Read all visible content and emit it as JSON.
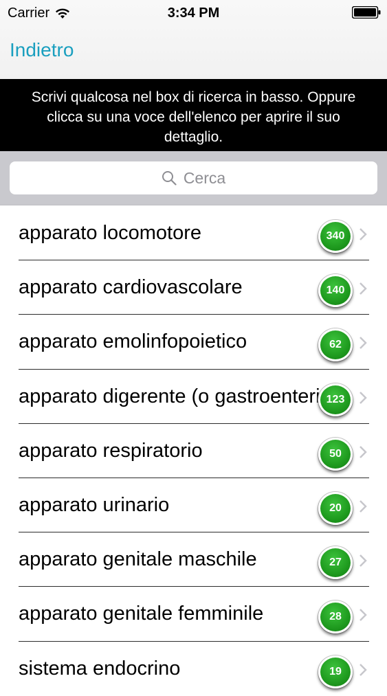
{
  "status_bar": {
    "carrier": "Carrier",
    "time": "3:34 PM"
  },
  "nav": {
    "back_label": "Indietro"
  },
  "info_banner": {
    "lines": [
      "Scrivi qualcosa nel box di ricerca in basso. Oppure",
      "clicca su una voce dell'elenco per aprire il suo",
      "dettaglio."
    ]
  },
  "search": {
    "placeholder": "Cerca"
  },
  "items": [
    {
      "label": "apparato locomotore",
      "count": "340"
    },
    {
      "label": "apparato cardiovascolare",
      "count": "140"
    },
    {
      "label": "apparato emolinfopoietico",
      "count": "62"
    },
    {
      "label": "apparato digerente (o gastroenterico)",
      "count": "123"
    },
    {
      "label": "apparato respiratorio",
      "count": "50"
    },
    {
      "label": "apparato urinario",
      "count": "20"
    },
    {
      "label": "apparato genitale maschile",
      "count": "27"
    },
    {
      "label": "apparato genitale femminile",
      "count": "28"
    },
    {
      "label": "sistema endocrino",
      "count": "19"
    }
  ],
  "colors": {
    "accent": "#1a9fbf",
    "badge": "#1f9b1f",
    "banner": "#000000"
  }
}
